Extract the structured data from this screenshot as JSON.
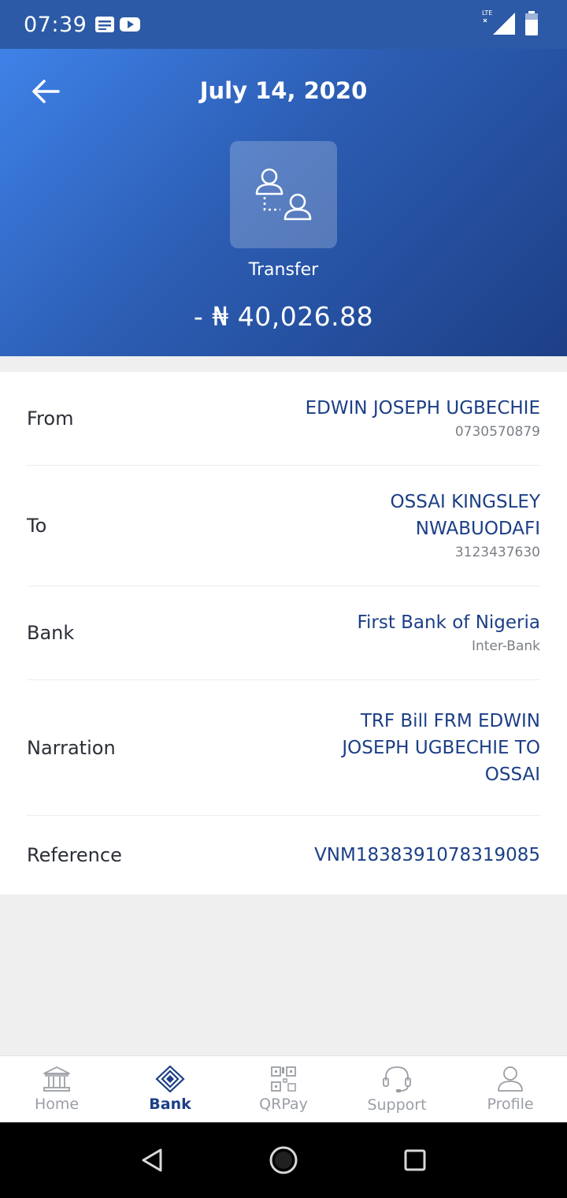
{
  "status_bar": {
    "time": "07:39",
    "network": "LTE"
  },
  "header": {
    "date": "July 14, 2020",
    "transaction_type": "Transfer",
    "amount": "- ₦ 40,026.88"
  },
  "details": {
    "from": {
      "label": "From",
      "name": "EDWIN JOSEPH UGBECHIE",
      "account": "0730570879"
    },
    "to": {
      "label": "To",
      "name_line1": "OSSAI KINGSLEY",
      "name_line2": "NWABUODAFI",
      "account": "3123437630"
    },
    "bank": {
      "label": "Bank",
      "name": "First Bank of Nigeria",
      "type": "Inter-Bank"
    },
    "narration": {
      "label": "Narration",
      "line1": "TRF Bill FRM EDWIN",
      "line2": "JOSEPH UGBECHIE TO",
      "line3": "OSSAI"
    },
    "reference": {
      "label": "Reference",
      "value": "VNM1838391078319085"
    }
  },
  "bottom_nav": {
    "items": [
      {
        "label": "Home",
        "icon": "bank-building-icon",
        "active": false
      },
      {
        "label": "Bank",
        "icon": "diamond-icon",
        "active": true
      },
      {
        "label": "QRPay",
        "icon": "qr-code-icon",
        "active": false
      },
      {
        "label": "Support",
        "icon": "headset-icon",
        "active": false
      },
      {
        "label": "Profile",
        "icon": "user-icon",
        "active": false
      }
    ]
  },
  "colors": {
    "primary": "#1c3f86",
    "header_start": "#3f82e8",
    "header_end": "#1d3f86",
    "inactive": "#9a9ea5"
  }
}
